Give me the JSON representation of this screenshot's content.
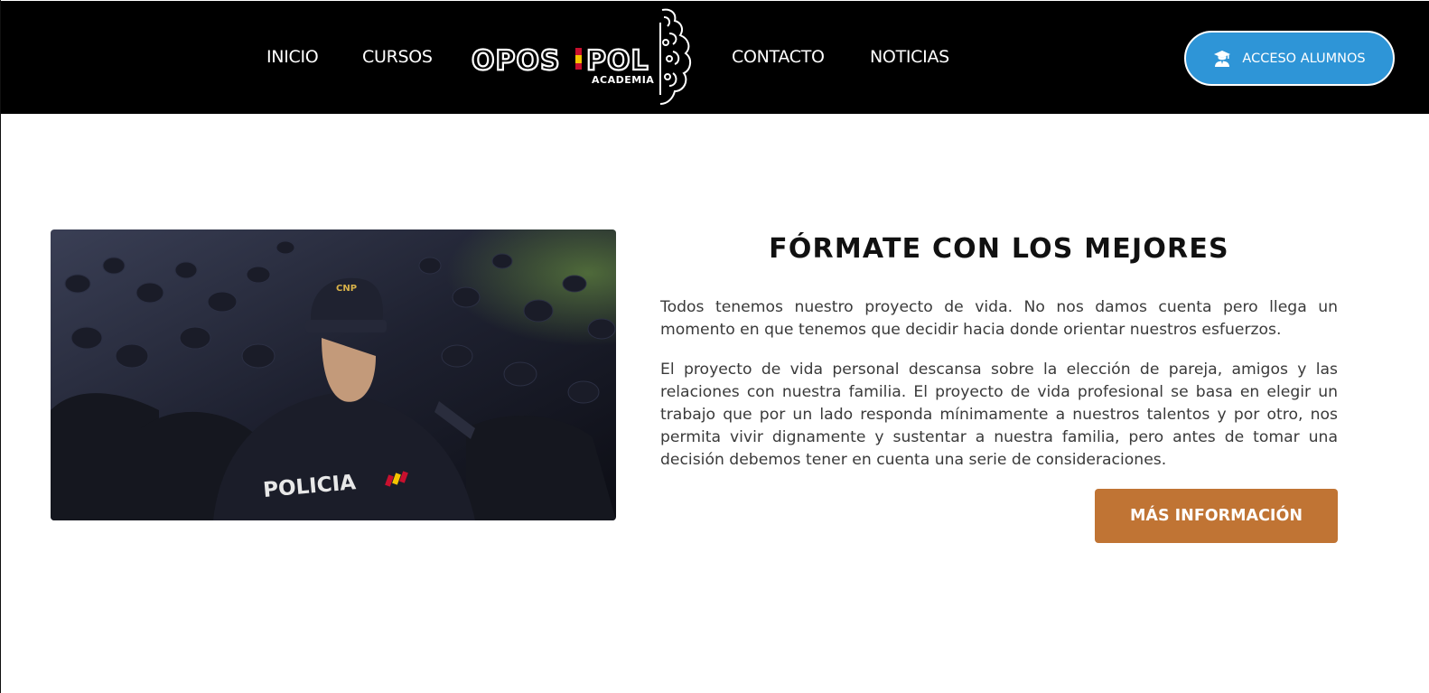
{
  "nav": {
    "items": [
      {
        "label": "INICIO"
      },
      {
        "label": "CURSOS"
      },
      {
        "label": "CONTACTO"
      },
      {
        "label": "NOTICIAS"
      }
    ],
    "logo": {
      "name": "OPOS|POL",
      "subtitle": "ACADEMIA"
    },
    "access_button": {
      "label": "ACCESO ALUMNOS",
      "icon": "student-graduate-icon"
    }
  },
  "main": {
    "title": "FÓRMATE CON LOS MEJORES",
    "paragraphs": [
      "Todos tenemos nuestro proyecto de vida. No nos damos cuenta pero llega un momento en que tenemos que decidir hacia donde orientar nuestros esfuerzos.",
      "El proyecto de vida personal descansa sobre la elección de pareja, amigos y las relaciones con nuestra familia. El proyecto de vida profesional se basa en elegir un trabajo que por un lado responda mínimamente a nuestros talentos y por otro, nos permita vivir dignamente y sustentar a nuestra familia, pero antes de tomar una decisión debemos tener en cuenta una serie de consideraciones."
    ],
    "image": {
      "labels": [
        "CNP",
        "POLICIA"
      ]
    },
    "more_button": {
      "label": "MÁS INFORMACIÓN"
    }
  },
  "colors": {
    "header_bg": "#000000",
    "access_button": "#2e95d7",
    "more_button": "#c07434",
    "title": "#111111",
    "text": "#3a3a3a"
  }
}
